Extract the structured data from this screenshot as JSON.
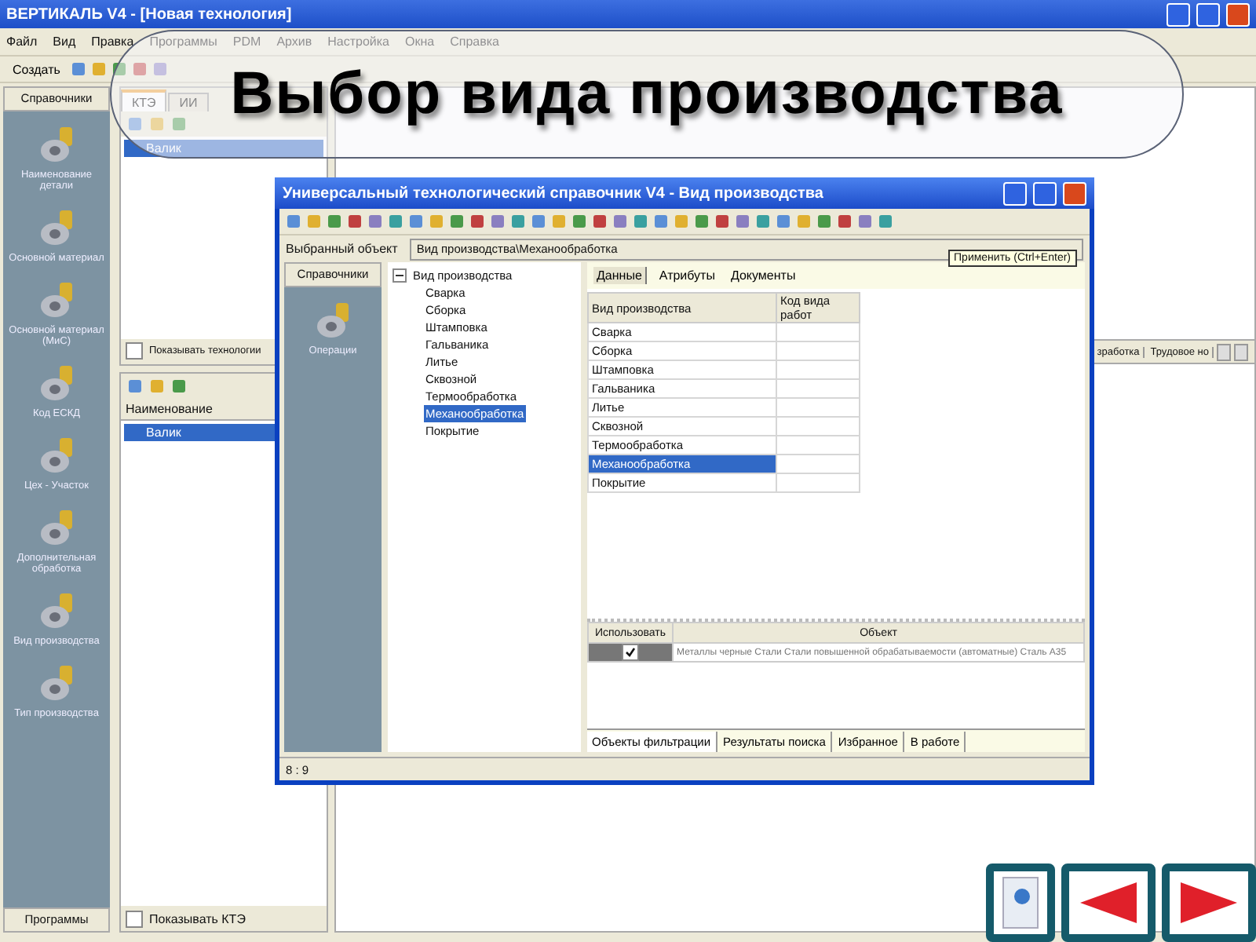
{
  "window": {
    "title": "ВЕРТИКАЛЬ V4 - [Новая технология]"
  },
  "menu": [
    "Файл",
    "Вид",
    "Правка",
    "Программы",
    "PDM",
    "Архив",
    "Настройка",
    "Окна",
    "Справка"
  ],
  "toolbar": {
    "create": "Создать"
  },
  "slide_title": "Выбор вида производства",
  "sidebar": {
    "header": "Справочники",
    "items": [
      "Наименование детали",
      "Основной материал",
      "Основной материал (МиС)",
      "Код ЕСКД",
      "Цех - Участок",
      "Дополнительная обработка",
      "Вид производства",
      "Тип производства"
    ],
    "footer": "Программы"
  },
  "ktz_panel": {
    "tabs": [
      {
        "label": "КТЭ",
        "selected": true
      },
      {
        "label": "ИИ",
        "selected": false
      }
    ],
    "tree": [
      {
        "label": "Валик",
        "selected": true
      }
    ],
    "checkbox": {
      "label": "Показывать технологии",
      "checked": false
    }
  },
  "list_panel": {
    "column": "Наименование",
    "rows": [
      {
        "label": "Валик",
        "selected": true
      }
    ],
    "checkbox": {
      "label": "Показывать КТЭ",
      "checked": false
    }
  },
  "right_tabs": [
    "зработка",
    "Трудовое но"
  ],
  "dialog": {
    "title": "Универсальный технологический справочник V4 - Вид производства",
    "selected_object": {
      "label": "Выбранный объект",
      "value": "Вид производства\\Механообработка"
    },
    "tooltip": "Применить (Ctrl+Enter)",
    "side": {
      "header": "Справочники",
      "items": [
        "Операции"
      ]
    },
    "tree": {
      "root": "Вид производства",
      "expanded": true,
      "children": [
        {
          "label": "Сварка",
          "selected": false
        },
        {
          "label": "Сборка",
          "selected": false
        },
        {
          "label": "Штамповка",
          "selected": false
        },
        {
          "label": "Гальваника",
          "selected": false
        },
        {
          "label": "Литье",
          "selected": false
        },
        {
          "label": "Сквозной",
          "selected": false
        },
        {
          "label": "Термообработка",
          "selected": false
        },
        {
          "label": "Механообработка",
          "selected": true
        },
        {
          "label": "Покрытие",
          "selected": false
        }
      ]
    },
    "tabs": [
      {
        "label": "Данные",
        "selected": true
      },
      {
        "label": "Атрибуты",
        "selected": false
      },
      {
        "label": "Документы",
        "selected": false
      }
    ],
    "table": {
      "columns": [
        "Вид производства",
        "Код вида работ"
      ],
      "rows": [
        {
          "name": "Сварка",
          "selected": false
        },
        {
          "name": "Сборка",
          "selected": false
        },
        {
          "name": "Штамповка",
          "selected": false
        },
        {
          "name": "Гальваника",
          "selected": false
        },
        {
          "name": "Литье",
          "selected": false
        },
        {
          "name": "Сквозной",
          "selected": false
        },
        {
          "name": "Термообработка",
          "selected": false
        },
        {
          "name": "Механообработка",
          "selected": true
        },
        {
          "name": "Покрытие",
          "selected": false
        }
      ]
    },
    "filter": {
      "columns": [
        "Использовать",
        "Объект"
      ],
      "rows": [
        {
          "checked": true,
          "object": "Металлы черные Стали Стали повышенной обрабатываемости (автоматные) Сталь А35"
        }
      ]
    },
    "bottom_tabs": [
      {
        "label": "Объекты фильтрации",
        "selected": true
      },
      {
        "label": "Результаты поиска",
        "selected": false
      },
      {
        "label": "Избранное",
        "selected": false
      },
      {
        "label": "В работе",
        "selected": false
      }
    ],
    "status": "8 : 9"
  },
  "nav_buttons": [
    {
      "kind": "book"
    },
    {
      "kind": "prev"
    },
    {
      "kind": "next"
    }
  ]
}
